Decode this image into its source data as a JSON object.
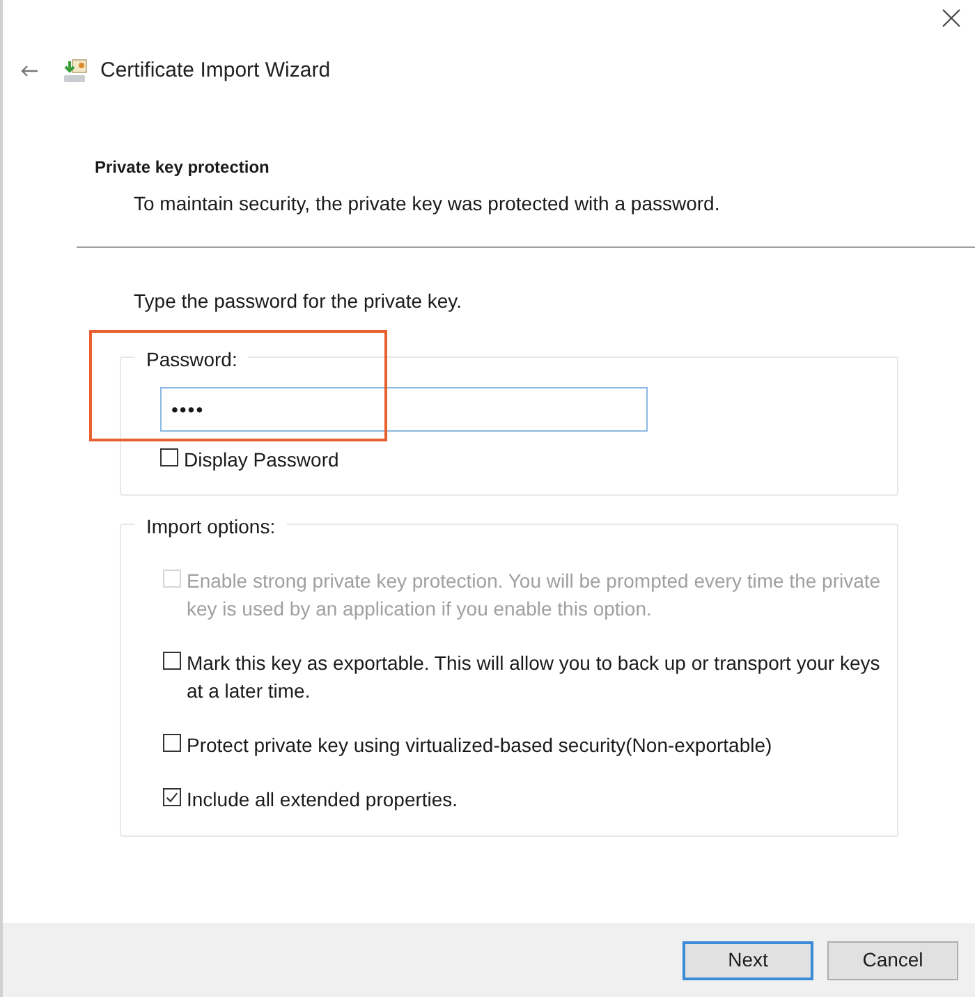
{
  "window": {
    "title": "Certificate Import Wizard"
  },
  "header": {
    "title": "Private key protection",
    "subtitle": "To maintain security, the private key was protected with a password."
  },
  "instruction": "Type the password for the private key.",
  "password_group": {
    "label": "Password:",
    "value": "••••",
    "highlighted": true,
    "display_password": {
      "label": "Display Password",
      "checked": false
    }
  },
  "import_options": {
    "label": "Import options:",
    "options": [
      {
        "label": "Enable strong private key protection. You will be prompted every time the private key is used by an application if you enable this option.",
        "checked": false,
        "disabled": true
      },
      {
        "label": "Mark this key as exportable. This will allow you to back up or transport your keys at a later time.",
        "checked": false,
        "disabled": false
      },
      {
        "label": "Protect private key using virtualized-based security(Non-exportable)",
        "checked": false,
        "disabled": false
      },
      {
        "label": "Include all extended properties.",
        "checked": true,
        "disabled": false
      }
    ]
  },
  "buttons": [
    {
      "label": "Next",
      "default": true
    },
    {
      "label": "Cancel",
      "default": false
    }
  ]
}
